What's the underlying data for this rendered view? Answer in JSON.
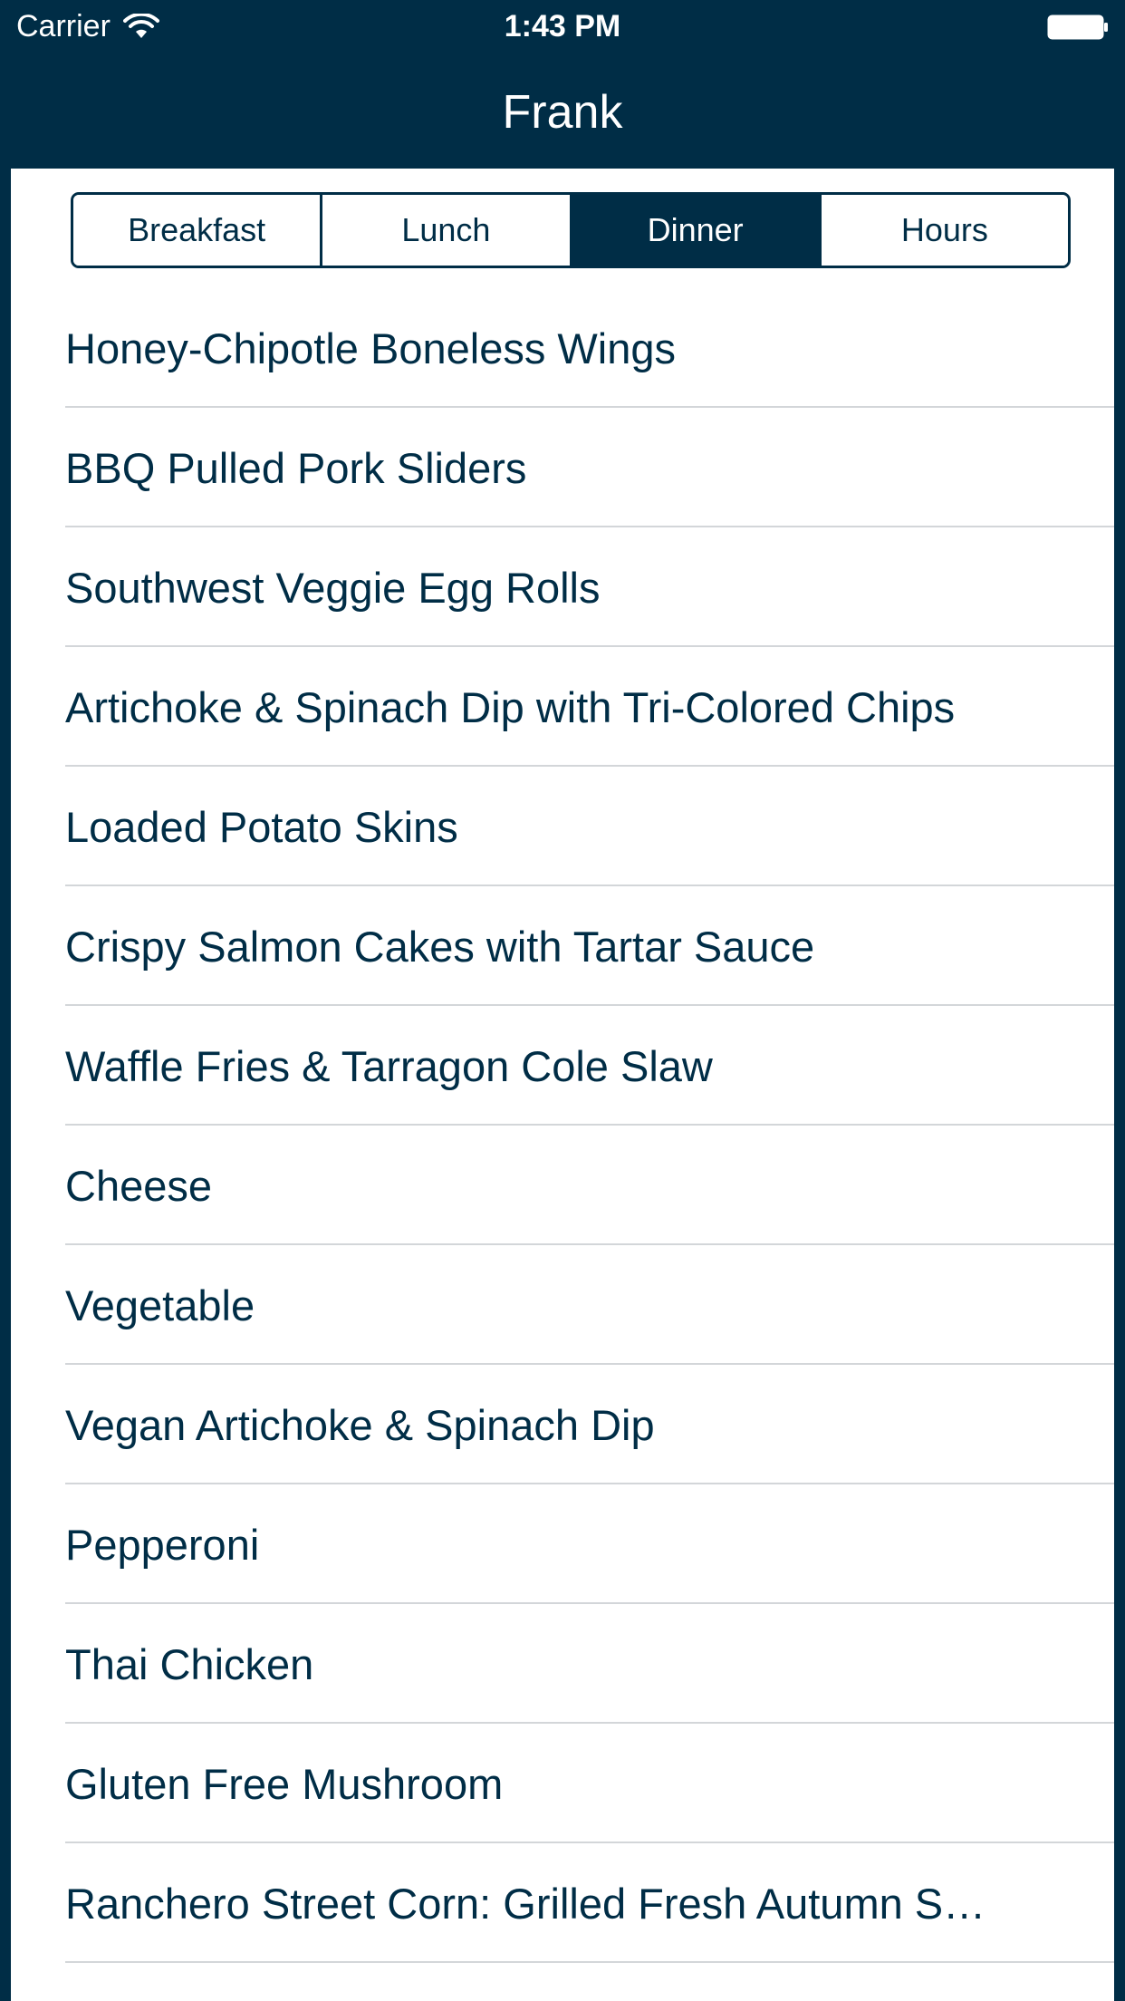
{
  "status_bar": {
    "carrier": "Carrier",
    "time": "1:43 PM",
    "wifi_icon": "wifi-icon",
    "battery_icon": "battery-icon"
  },
  "nav": {
    "title": "Frank"
  },
  "segments": [
    {
      "label": "Breakfast",
      "selected": false
    },
    {
      "label": "Lunch",
      "selected": false
    },
    {
      "label": "Dinner",
      "selected": true
    },
    {
      "label": "Hours",
      "selected": false
    }
  ],
  "menu_items": [
    "Honey-Chipotle Boneless Wings",
    "BBQ Pulled Pork Sliders",
    "Southwest Veggie Egg Rolls",
    "Artichoke & Spinach Dip with Tri-Colored Chips",
    "Loaded Potato Skins",
    "Crispy Salmon Cakes with Tartar Sauce",
    "Waffle Fries & Tarragon Cole Slaw",
    "Cheese",
    "Vegetable",
    "Vegan Artichoke & Spinach Dip",
    "Pepperoni",
    "Thai Chicken",
    "Gluten Free Mushroom",
    "Ranchero Street Corn: Grilled Fresh Autumn S…"
  ],
  "colors": {
    "primary": "#002d46",
    "background": "#ffffff",
    "separator": "#d3d6d9"
  }
}
